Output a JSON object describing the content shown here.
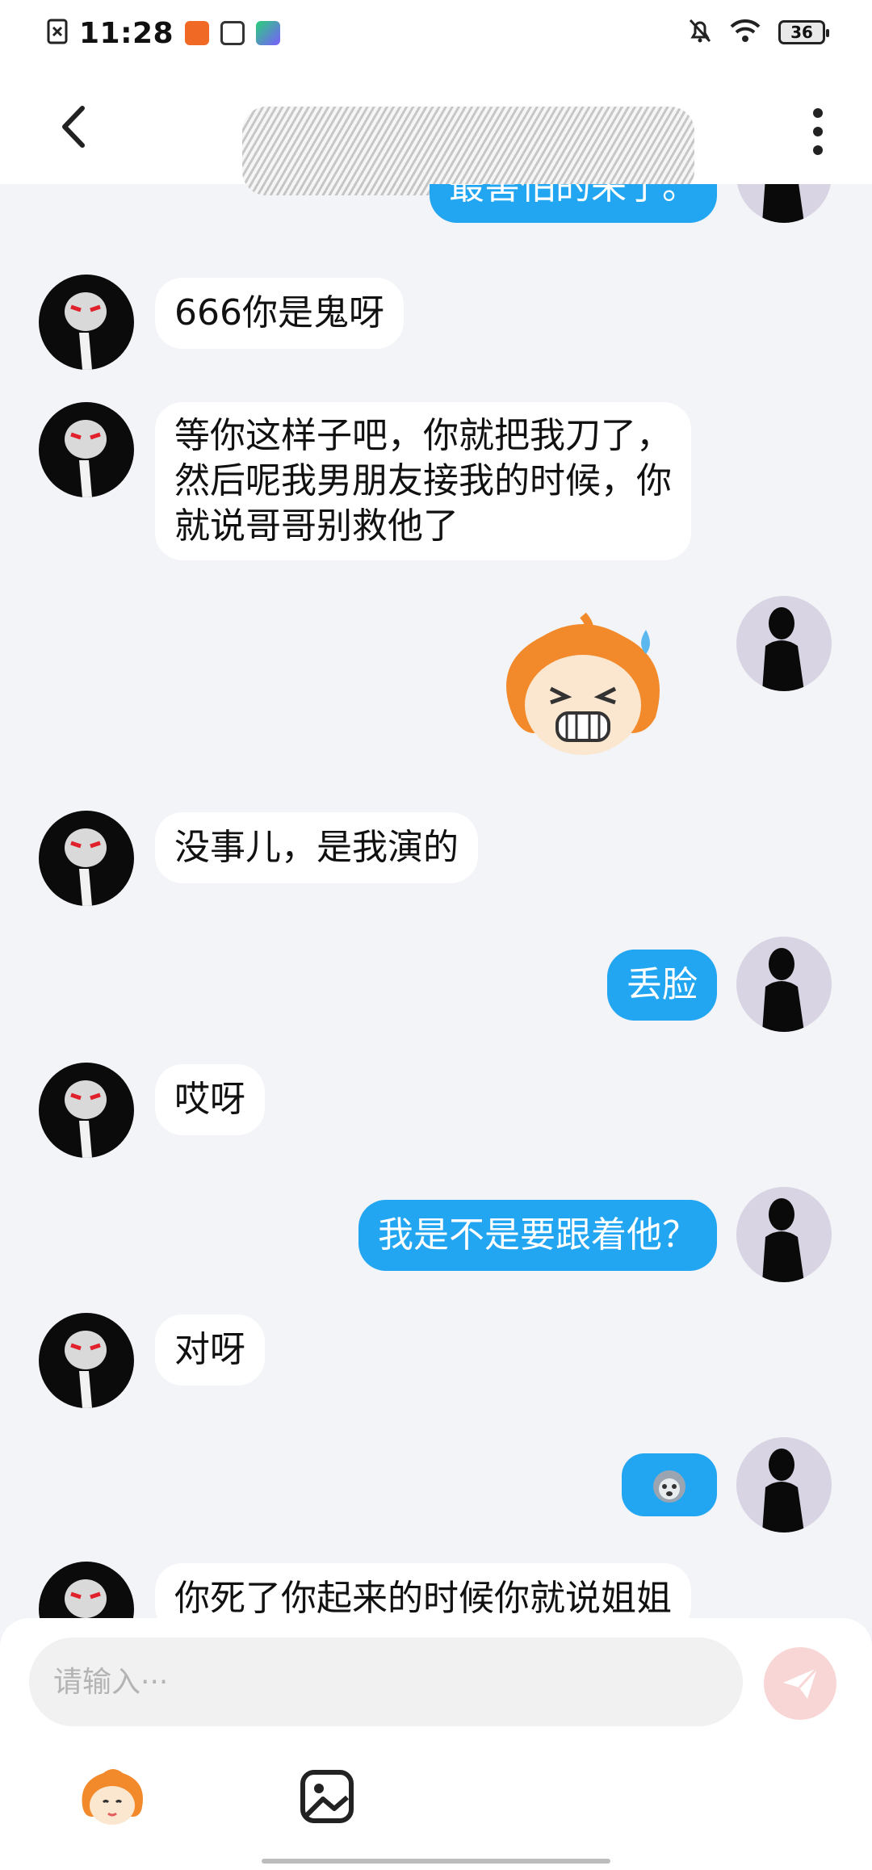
{
  "status_bar": {
    "time": "11:28",
    "battery": "36",
    "icons": [
      "sim-error-icon",
      "app-orange-icon",
      "app-grey-icon",
      "app-green-icon",
      "mute-bell-icon",
      "wifi-icon",
      "battery-icon"
    ]
  },
  "header": {
    "back_icon": "chevron-left-icon",
    "more_icon": "more-vertical-icon",
    "title_obscured": true
  },
  "messages": [
    {
      "side": "out",
      "type": "text",
      "text": "最害怕的来了。"
    },
    {
      "side": "in",
      "type": "text",
      "text": "666你是鬼呀"
    },
    {
      "side": "in",
      "type": "text",
      "lines": [
        "等你这样子吧，你就把我刀了，",
        "然后呢我男朋友接我的时候，你",
        "就说哥哥别救他了"
      ]
    },
    {
      "side": "out",
      "type": "sticker",
      "sticker": "crying-orange-hair-sticker"
    },
    {
      "side": "in",
      "type": "text",
      "text": "没事儿，是我演的"
    },
    {
      "side": "out",
      "type": "text",
      "text": "丢脸"
    },
    {
      "side": "in",
      "type": "text",
      "text": "哎呀"
    },
    {
      "side": "out",
      "type": "text",
      "text": "我是不是要跟着他？"
    },
    {
      "side": "in",
      "type": "text",
      "text": "对呀"
    },
    {
      "side": "out",
      "type": "sticker",
      "sticker": "small-monkey-emoji"
    },
    {
      "side": "in",
      "type": "text",
      "text": "你死了你起来的时候你就说姐姐"
    }
  ],
  "input": {
    "placeholder": "请输入···",
    "send_icon": "send-paper-plane-icon"
  },
  "toolbar": {
    "emoji_icon": "emoji-sticker-icon",
    "image_icon": "image-gallery-icon"
  },
  "colors": {
    "out_bubble": "#23a6f2",
    "in_bubble": "#ffffff",
    "background": "#f3f4f8",
    "send_button": "#f9d6d6"
  }
}
